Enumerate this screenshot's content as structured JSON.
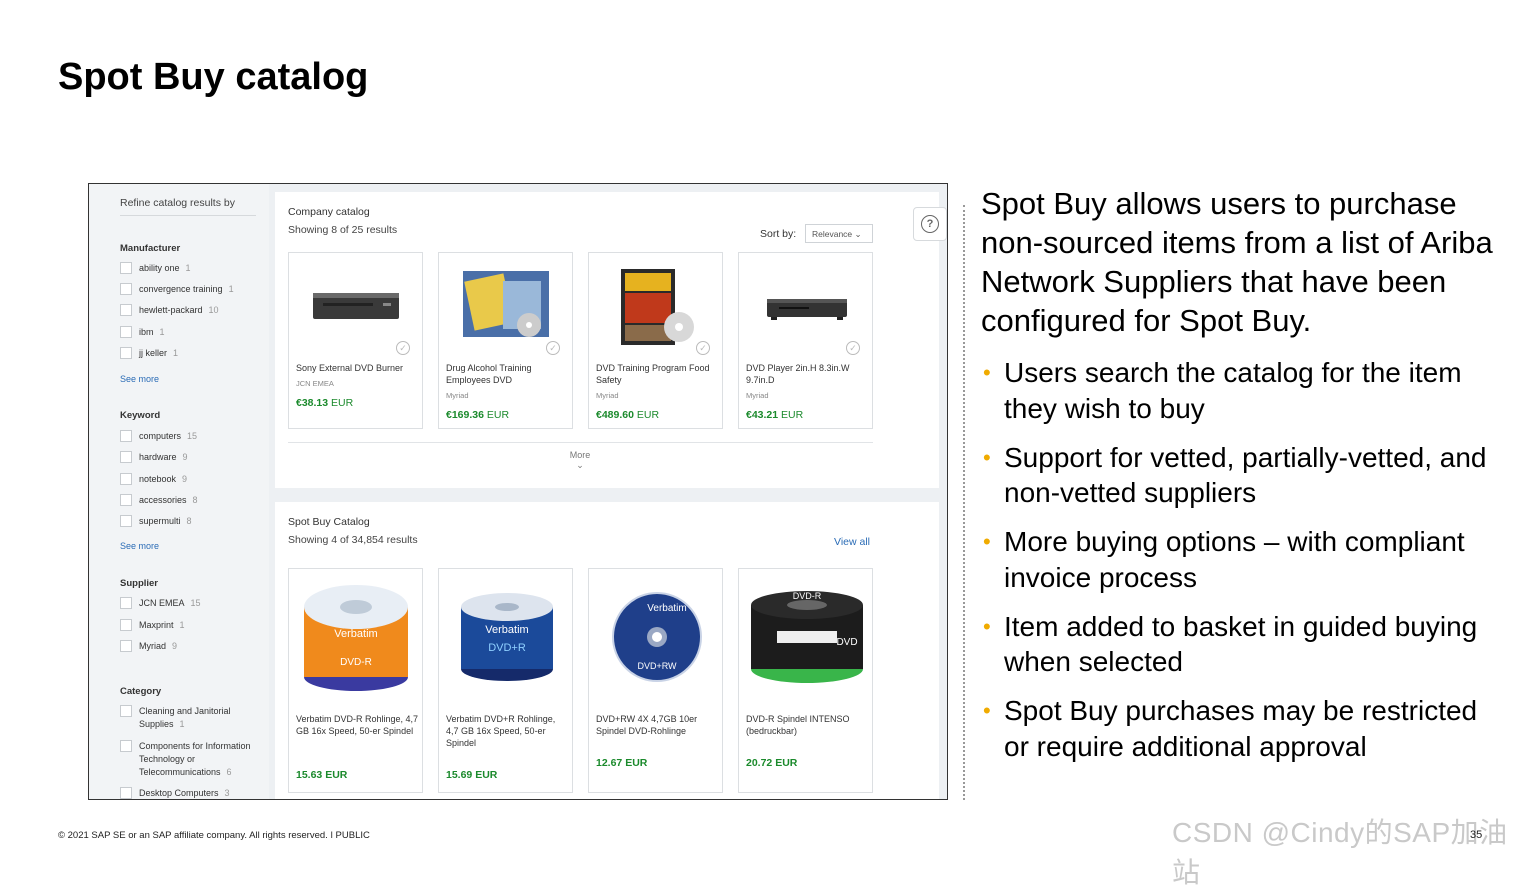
{
  "slide": {
    "title": "Spot Buy catalog",
    "intro": "Spot Buy allows users to purchase non-sourced items from a list of Ariba Network Suppliers that have been configured for Spot Buy.",
    "bullets": [
      "Users search the catalog for the item they wish to buy",
      "Support for vetted, partially-vetted, and non-vetted suppliers",
      "More buying options – with compliant invoice process",
      "Item added to basket in guided buying when selected",
      "Spot Buy purchases may be restricted or require additional approval"
    ],
    "bullet_color": "#f0ab00",
    "footer": "© 2021 SAP SE or an SAP affiliate company. All rights reserved.  ǀ  PUBLIC",
    "page_number": "35",
    "watermark": "CSDN @Cindy的SAP加油站"
  },
  "sidebar": {
    "refine_label": "Refine catalog results by",
    "see_more": "See more",
    "manufacturer": {
      "title": "Manufacturer",
      "items": [
        {
          "label": "ability one",
          "count": "1"
        },
        {
          "label": "convergence training",
          "count": "1"
        },
        {
          "label": "hewlett-packard",
          "count": "10"
        },
        {
          "label": "ibm",
          "count": "1"
        },
        {
          "label": "jj keller",
          "count": "1"
        }
      ]
    },
    "keyword": {
      "title": "Keyword",
      "items": [
        {
          "label": "computers",
          "count": "15"
        },
        {
          "label": "hardware",
          "count": "9"
        },
        {
          "label": "notebook",
          "count": "9"
        },
        {
          "label": "accessories",
          "count": "8"
        },
        {
          "label": "supermulti",
          "count": "8"
        }
      ]
    },
    "supplier": {
      "title": "Supplier",
      "items": [
        {
          "label": "JCN EMEA",
          "count": "15"
        },
        {
          "label": "Maxprint",
          "count": "1"
        },
        {
          "label": "Myriad",
          "count": "9"
        }
      ]
    },
    "category": {
      "title": "Category",
      "items": [
        {
          "label": "Cleaning and Janitorial Supplies",
          "count": "1"
        },
        {
          "label": "Components for Information Technology or Telecommunications",
          "count": "6"
        },
        {
          "label": "Desktop Computers",
          "count": "3"
        }
      ]
    }
  },
  "company_catalog": {
    "title": "Company catalog",
    "showing": "Showing 8 of 25 results",
    "sort_label": "Sort by:",
    "sort_value": "Relevance",
    "more_label": "More",
    "items": [
      {
        "name": "Sony External DVD Burner",
        "supplier": "JCN EMEA",
        "price": "€38.13",
        "currency": "EUR",
        "icon": "dvd-burner-image"
      },
      {
        "name": "Drug Alcohol Training Employees DVD",
        "supplier": "Myriad",
        "price": "€169.36",
        "currency": "EUR",
        "icon": "training-dvd-image"
      },
      {
        "name": "DVD Training Program Food Safety",
        "supplier": "Myriad",
        "price": "€489.60",
        "currency": "EUR",
        "icon": "food-safety-dvd-image"
      },
      {
        "name": "DVD Player 2in.H 8.3in.W 9.7in.D",
        "supplier": "Myriad",
        "price": "€43.21",
        "currency": "EUR",
        "icon": "dvd-player-image"
      }
    ]
  },
  "spot_buy_catalog": {
    "title": "Spot Buy Catalog",
    "showing": "Showing 4 of 34,854 results",
    "view_all": "View all",
    "items": [
      {
        "name": "Verbatim DVD-R Rohlinge, 4,7 GB 16x Speed, 50-er Spindel",
        "price": "15.63 EUR",
        "icon": "verbatim-dvd-r-spindle-image"
      },
      {
        "name": "Verbatim DVD+R Rohlinge, 4,7 GB 16x Speed, 50-er Spindel",
        "price": "15.69 EUR",
        "icon": "verbatim-dvd-plus-r-spindle-image"
      },
      {
        "name": "DVD+RW 4X 4,7GB 10er Spindel DVD-Rohlinge",
        "price": "12.67 EUR",
        "icon": "dvd-rw-disc-image"
      },
      {
        "name": "DVD-R Spindel INTENSO (bedruckbar)",
        "price": "20.72 EUR",
        "icon": "intenso-dvd-spindle-image"
      }
    ]
  }
}
